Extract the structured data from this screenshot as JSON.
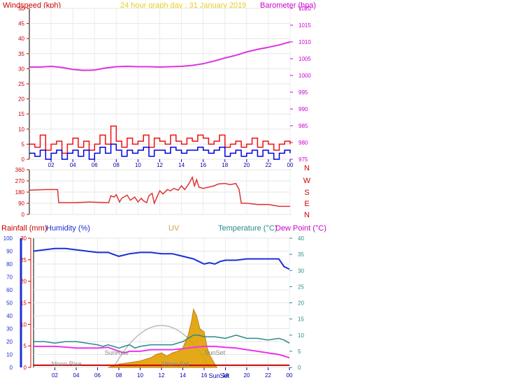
{
  "chart_data": [
    {
      "type": "line",
      "title": "24 hour graph day : 31 January 2019",
      "y_left_label": "Windspeed (kph)",
      "y_right_label": "Barometer (hpa)",
      "x_ticks": [
        "02",
        "04",
        "06",
        "08",
        "10",
        "12",
        "14",
        "16",
        "18",
        "20",
        "22",
        "00"
      ],
      "ylim_left": [
        0,
        50
      ],
      "y_left_ticks": [
        0,
        5,
        10,
        15,
        20,
        25,
        30,
        35,
        40,
        45,
        50
      ],
      "ylim_right": [
        975,
        1020
      ],
      "y_right_ticks": [
        975,
        980,
        985,
        990,
        995,
        1000,
        1005,
        1010,
        1015,
        1020
      ],
      "colors": {
        "wind_avg": "#0000dd",
        "wind_gust": "#ee1111",
        "barometer": "#dd33dd",
        "title": "#e8d020",
        "axis_left": "#cc0000",
        "axis_right": "#cc00cc"
      },
      "series": [
        {
          "name": "barometer",
          "axis": "right",
          "x": [
            0,
            1,
            2,
            3,
            4,
            5,
            6,
            7,
            8,
            9,
            10,
            11,
            12,
            13,
            14,
            15,
            16,
            17,
            18,
            19,
            20,
            21,
            22,
            23,
            24
          ],
          "values": [
            1002.5,
            1002.5,
            1002.7,
            1002.4,
            1001.8,
            1001.5,
            1001.6,
            1002.2,
            1002.6,
            1002.7,
            1002.6,
            1002.6,
            1002.5,
            1002.6,
            1002.7,
            1003.0,
            1003.5,
            1004.3,
            1005.2,
            1006.0,
            1007.0,
            1007.8,
            1008.4,
            1009.1,
            1010.0
          ]
        },
        {
          "name": "wind_gust",
          "axis": "left",
          "x": [
            0,
            0.5,
            1,
            1.5,
            2,
            2.5,
            3,
            3.5,
            4,
            4.5,
            5,
            5.5,
            6,
            6.5,
            7,
            7.5,
            8,
            8.5,
            9,
            9.5,
            10,
            10.5,
            11,
            11.5,
            12,
            12.5,
            13,
            13.5,
            14,
            14.5,
            15,
            15.5,
            16,
            16.5,
            17,
            17.5,
            18,
            18.5,
            19,
            19.5,
            20,
            20.5,
            21,
            21.5,
            22,
            22.5,
            23,
            23.5,
            24
          ],
          "values": [
            5,
            4,
            8,
            3,
            5,
            6,
            2,
            5,
            7,
            4,
            6,
            3,
            5,
            8,
            5,
            11,
            6,
            4,
            7,
            5,
            6,
            8,
            4,
            7,
            6,
            5,
            8,
            6,
            5,
            7,
            6,
            8,
            7,
            5,
            6,
            8,
            4,
            5,
            6,
            4,
            5,
            7,
            4,
            6,
            5,
            3,
            5,
            6,
            5
          ]
        },
        {
          "name": "wind_avg",
          "axis": "left",
          "x": [
            0,
            0.5,
            1,
            1.5,
            2,
            2.5,
            3,
            3.5,
            4,
            4.5,
            5,
            5.5,
            6,
            6.5,
            7,
            7.5,
            8,
            8.5,
            9,
            9.5,
            10,
            10.5,
            11,
            11.5,
            12,
            12.5,
            13,
            13.5,
            14,
            14.5,
            15,
            15.5,
            16,
            16.5,
            17,
            17.5,
            18,
            18.5,
            19,
            19.5,
            20,
            20.5,
            21,
            21.5,
            22,
            22.5,
            23,
            23.5,
            24
          ],
          "values": [
            2,
            1,
            3,
            0,
            2,
            3,
            0,
            2,
            3,
            1,
            3,
            0,
            2,
            4,
            2,
            5,
            3,
            1,
            3,
            2,
            3,
            4,
            1,
            3,
            3,
            2,
            4,
            3,
            2,
            3,
            3,
            4,
            3,
            2,
            3,
            4,
            1,
            2,
            3,
            1,
            2,
            3,
            1,
            3,
            2,
            0,
            2,
            3,
            2
          ]
        }
      ]
    },
    {
      "type": "line",
      "ylim": [
        0,
        360
      ],
      "y_ticks": [
        0,
        90,
        180,
        270,
        360
      ],
      "direction_labels": [
        "N",
        "W",
        "S",
        "E",
        "N"
      ],
      "colors": {
        "line": "#dd3333",
        "direction_labels": "#cc0000"
      },
      "series": [
        {
          "name": "wind_direction",
          "x": [
            0,
            1.5,
            2.6,
            2.7,
            4,
            5.5,
            5.6,
            7.3,
            7.5,
            7.8,
            8,
            8.3,
            8.5,
            9,
            9.3,
            9.7,
            10,
            10.3,
            10.5,
            10.8,
            11,
            11.3,
            11.5,
            12,
            12.3,
            12.7,
            13,
            13.3,
            13.7,
            14,
            14.3,
            14.7,
            15,
            15.2,
            15.4,
            15.6,
            16,
            16.5,
            17,
            17.4,
            18,
            18.5,
            19,
            19.3,
            19.5,
            20,
            21,
            22,
            23,
            24
          ],
          "values": [
            195,
            200,
            200,
            95,
            95,
            100,
            100,
            95,
            150,
            140,
            160,
            100,
            130,
            155,
            115,
            140,
            100,
            130,
            110,
            95,
            150,
            170,
            90,
            190,
            165,
            200,
            190,
            210,
            195,
            230,
            200,
            250,
            300,
            230,
            280,
            220,
            210,
            220,
            230,
            245,
            250,
            240,
            250,
            200,
            90,
            90,
            80,
            80,
            65,
            65
          ]
        }
      ]
    },
    {
      "type": "line",
      "labels": {
        "rainfall": "Rainfall (mm)",
        "humidity": "Humidity (%)",
        "uv": "UV",
        "temperature": "Temperature (°C)",
        "dewpoint": "Dew Point (°C)"
      },
      "annotations": [
        "Moon Rise",
        "SunRise",
        "Moon Set",
        "SunSet",
        "SunSet"
      ],
      "ylim_humidity": [
        0,
        100
      ],
      "humidity_ticks": [
        0,
        10,
        20,
        30,
        40,
        50,
        60,
        70,
        80,
        90,
        100
      ],
      "ylim_rain": [
        0,
        30
      ],
      "rain_ticks": [
        0,
        5,
        10,
        15,
        20,
        25,
        30
      ],
      "ylim_temp": [
        0,
        40
      ],
      "temp_ticks": [
        0,
        5,
        10,
        15,
        20,
        25,
        30,
        35,
        40
      ],
      "colors": {
        "humidity": "#1a2fd6",
        "temperature": "#2a8a8a",
        "dewpoint": "#ee33ee",
        "uv_fill": "#e0a000",
        "uv_line": "#c07000",
        "solar_arc": "#bbbbbb",
        "rainfall": "#cc0000",
        "uv_label": "#d8a040"
      },
      "series": [
        {
          "name": "humidity",
          "x": [
            0,
            1,
            2,
            3,
            4,
            5,
            6,
            7,
            8,
            8.5,
            9,
            10,
            11,
            12,
            13,
            14,
            15,
            15.5,
            16,
            16.5,
            17,
            17.5,
            18,
            19,
            20,
            21,
            22,
            23,
            23.5,
            24
          ],
          "values": [
            90,
            91,
            92,
            92,
            91,
            90,
            89,
            89,
            86,
            87,
            88,
            89,
            89,
            88,
            88,
            86,
            84,
            82,
            80,
            81,
            80,
            82,
            83,
            83,
            84,
            84,
            84,
            84,
            78,
            76
          ]
        },
        {
          "name": "temperature",
          "x": [
            0,
            1,
            2,
            3,
            4,
            5,
            6,
            6.5,
            7,
            7.5,
            8,
            8.5,
            9,
            9.5,
            10,
            11,
            12,
            13,
            14,
            14.5,
            15,
            15.5,
            16,
            17,
            18,
            19,
            20,
            21,
            22,
            23,
            23.5,
            24
          ],
          "values": [
            8,
            8,
            7.5,
            8,
            8,
            7.5,
            7,
            6.5,
            7,
            6.5,
            6,
            6.5,
            7,
            6,
            6.5,
            7,
            7,
            7,
            8,
            9,
            10,
            10,
            9.5,
            9.5,
            9,
            10,
            9,
            9,
            8.5,
            9,
            8.5,
            7.5
          ]
        },
        {
          "name": "dewpoint",
          "x": [
            0,
            1,
            2,
            3,
            4,
            5,
            6,
            7,
            8,
            8.5,
            9,
            10,
            11,
            12,
            13,
            14,
            15,
            16,
            17,
            18,
            19,
            20,
            21,
            22,
            23,
            24
          ],
          "values": [
            6.5,
            6.5,
            6.5,
            6.3,
            6,
            6,
            6,
            6.2,
            5,
            4.5,
            5,
            5,
            5.5,
            5.5,
            5.5,
            5.8,
            6.2,
            6.5,
            6.5,
            6.2,
            6,
            5.5,
            5,
            4.5,
            4,
            3
          ]
        },
        {
          "name": "uv",
          "x": [
            7,
            7.5,
            8,
            9,
            10,
            10.5,
            11,
            11.5,
            12,
            12.5,
            13,
            13.5,
            14,
            14.5,
            14.8,
            15,
            15.3,
            15.6,
            16,
            16.3,
            16.5,
            17,
            17.2
          ],
          "values": [
            0,
            0.5,
            1,
            1.5,
            2,
            2.5,
            3,
            4,
            4.5,
            3.5,
            4.5,
            5,
            6,
            10,
            14,
            18,
            16,
            12,
            11,
            6,
            4,
            1,
            0
          ]
        },
        {
          "name": "rainfall",
          "x": [
            0,
            24
          ],
          "values": [
            0.5,
            0.5
          ]
        }
      ]
    }
  ]
}
